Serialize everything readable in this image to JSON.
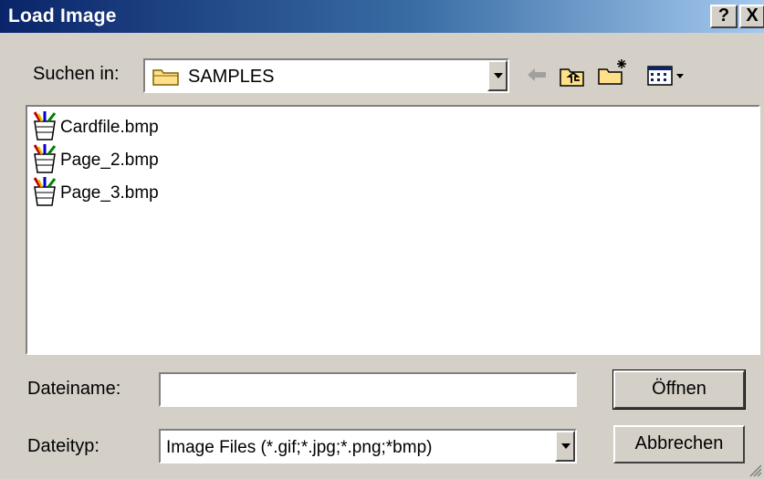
{
  "window": {
    "title": "Load Image",
    "help_label": "?",
    "close_label": "X"
  },
  "lookin": {
    "label": "Suchen in:",
    "value": "SAMPLES"
  },
  "toolbar": {
    "icons": [
      "back-arrow-icon",
      "up-folder-icon",
      "new-folder-icon",
      "view-menu-icon"
    ]
  },
  "files": [
    {
      "name": "Cardfile.bmp",
      "icon": "paint-bitmap-icon"
    },
    {
      "name": "Page_2.bmp",
      "icon": "paint-bitmap-icon"
    },
    {
      "name": "Page_3.bmp",
      "icon": "paint-bitmap-icon"
    }
  ],
  "filename": {
    "label": "Dateiname:",
    "value": ""
  },
  "filetype": {
    "label": "Dateityp:",
    "value": "Image Files (*.gif;*.jpg;*.png;*bmp)"
  },
  "buttons": {
    "open": "Öffnen",
    "cancel": "Abbrechen"
  },
  "colors": {
    "titlebar_start": "#0a246a",
    "titlebar_end": "#a6caf0",
    "face": "#d4d0c8"
  }
}
